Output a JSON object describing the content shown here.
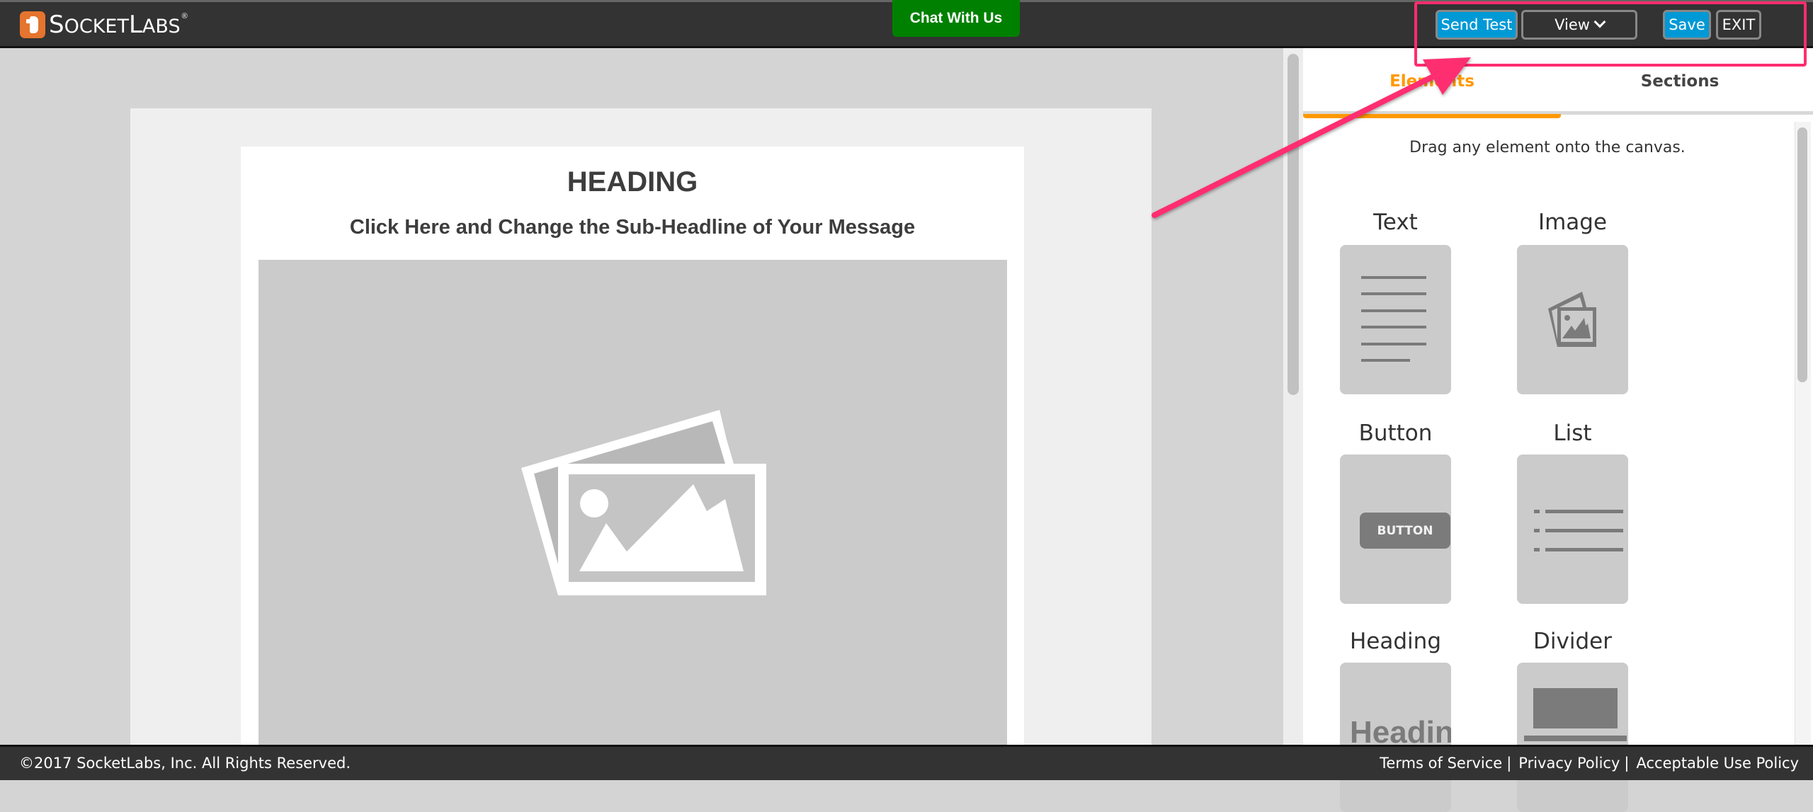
{
  "header": {
    "logo_text_big": "S",
    "logo_text_rest": "OCKET",
    "logo_text_big2": "L",
    "logo_text_rest2": "ABS",
    "logo_reg": "®",
    "chat_label": "Chat With Us",
    "send_test_label": "Send Test",
    "view_label": "View",
    "save_label": "Save",
    "exit_label": "EXIT"
  },
  "canvas": {
    "heading": "HEADING",
    "subheading": "Click Here and Change the Sub-Headline of Your Message",
    "image_placeholder_icon": "image-placeholder-icon"
  },
  "panel": {
    "tabs": [
      {
        "label": "Elements",
        "active": true
      },
      {
        "label": "Sections",
        "active": false
      }
    ],
    "hint": "Drag any element onto the canvas.",
    "elements": [
      {
        "label": "Text",
        "icon": "text-lines-icon"
      },
      {
        "label": "Image",
        "icon": "image-icon"
      },
      {
        "label": "Button",
        "icon": "button-icon",
        "preview_text": "BUTTON"
      },
      {
        "label": "List",
        "icon": "list-icon"
      },
      {
        "label": "Heading",
        "icon": "heading-icon",
        "preview_text": "Heading"
      },
      {
        "label": "Divider",
        "icon": "divider-icon"
      }
    ]
  },
  "footer": {
    "copyright": "©2017 SocketLabs, Inc. All Rights Reserved.",
    "links": [
      "Terms of Service",
      "Privacy Policy",
      "Acceptable Use Policy"
    ],
    "separator": "|"
  },
  "colors": {
    "header_bg": "#333333",
    "accent_orange": "#ff9900",
    "button_blue": "#0099d6",
    "chat_green": "#008000",
    "annotation_pink": "#ff2d6f"
  }
}
